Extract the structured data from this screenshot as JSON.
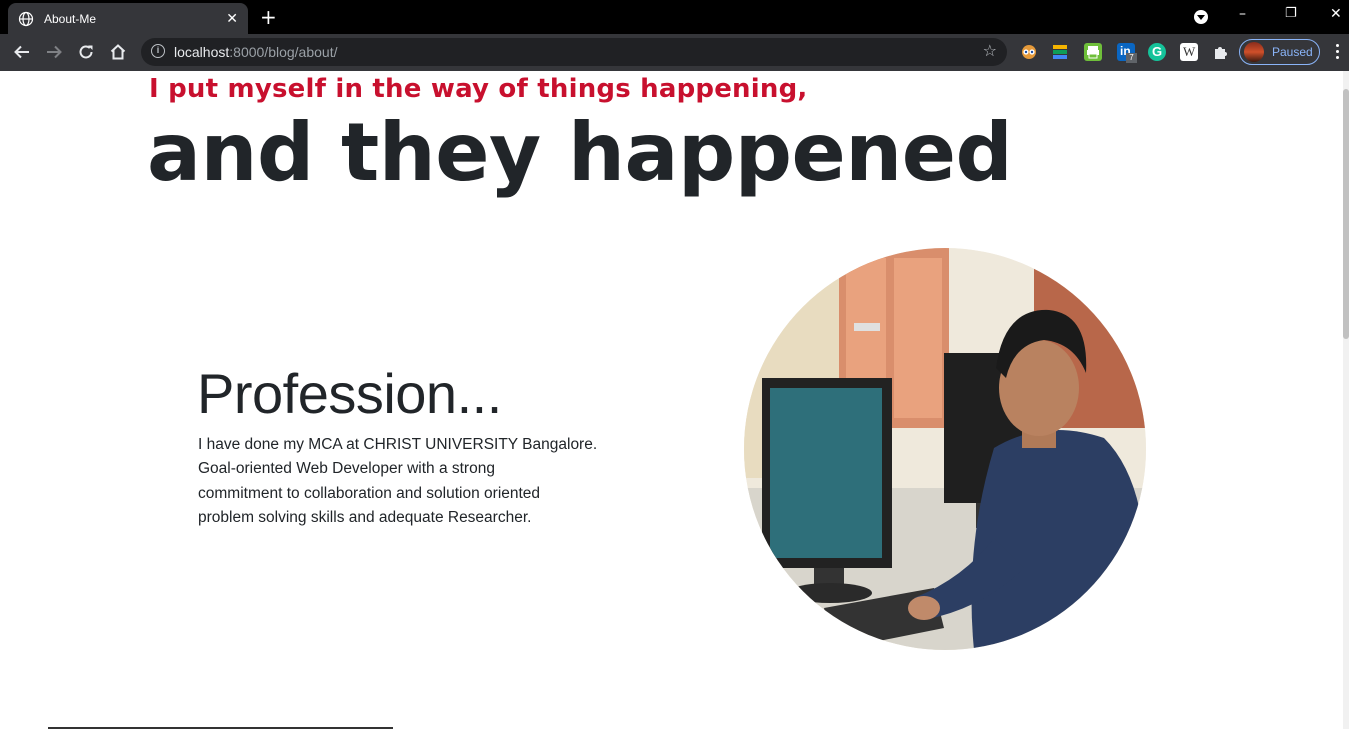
{
  "browser": {
    "tab_title": "About-Me",
    "new_tab_symbol": "+",
    "close_symbol": "✕",
    "url_host": "localhost",
    "url_rest": ":8000/blog/about/",
    "profile_status": "Paused",
    "window_controls": [
      "–",
      "❐",
      "✕"
    ],
    "extensions": [
      "extension-eyes-icon",
      "extension-stack-icon",
      "extension-print-icon",
      "extension-linkedin-icon",
      "extension-grammarly-icon",
      "extension-w-icon",
      "extensions-puzzle-icon"
    ],
    "linkedin_badge": "7",
    "grammarly_letter": "G",
    "w_letter": "W"
  },
  "hero": {
    "tagline": "I put myself in the way of things happening,",
    "headline": "and they happened"
  },
  "profession": {
    "title": "Profession...",
    "lines": [
      "I have done my MCA at CHRIST UNIVERSITY Bangalore.",
      "Goal-oriented Web Developer with a strong",
      "commitment to collaboration and solution oriented",
      "problem solving skills and adequate Researcher."
    ]
  },
  "colors": {
    "accent_red": "#c8102e",
    "heading_dark": "#212529",
    "chrome_dark": "#35363a",
    "profile_blue": "#8ab4f8"
  }
}
